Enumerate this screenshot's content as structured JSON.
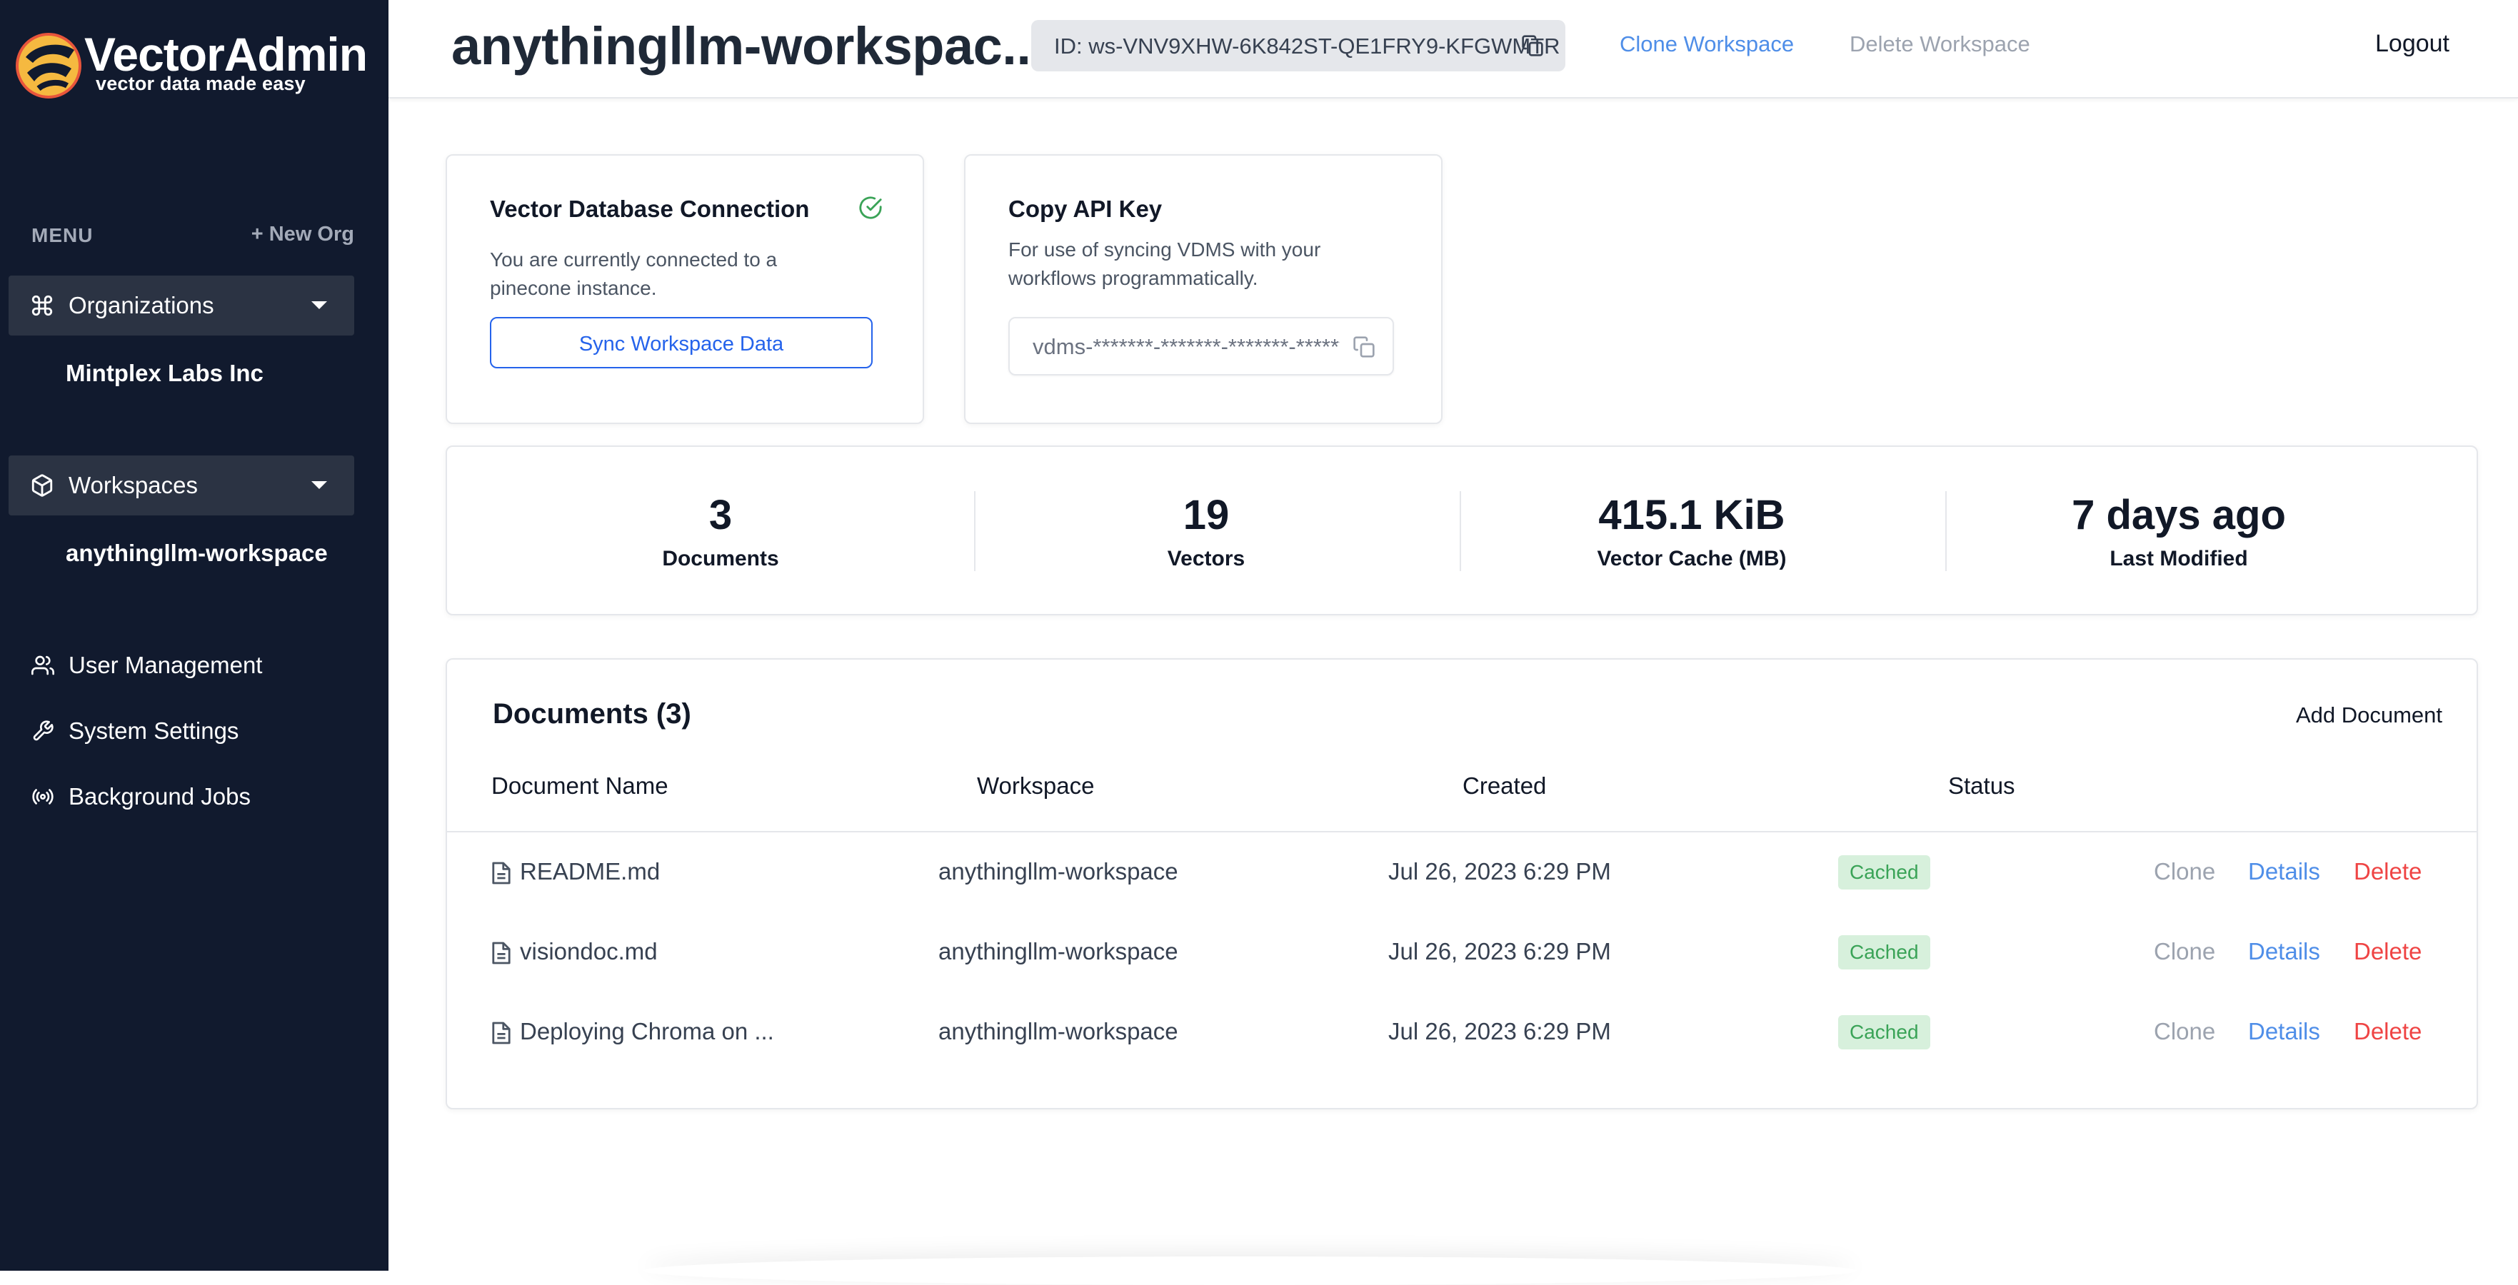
{
  "app": {
    "name": "VectorAdmin",
    "tagline": "vector data made easy",
    "colors": {
      "sidebar_bg": "#111a2e",
      "accent": "#2563eb",
      "cached": "#3aa357",
      "danger": "#ef4444"
    }
  },
  "sidebar": {
    "menu_label": "MENU",
    "new_org_label": "+ New Org",
    "organizations": {
      "label": "Organizations",
      "icon": "command-icon",
      "items": [
        "Mintplex Labs Inc"
      ]
    },
    "workspaces": {
      "label": "Workspaces",
      "icon": "cube-icon",
      "items": [
        "anythingllm-workspace"
      ]
    },
    "links": [
      {
        "label": "User Management",
        "icon": "users-icon"
      },
      {
        "label": "System Settings",
        "icon": "wrench-icon"
      },
      {
        "label": "Background Jobs",
        "icon": "broadcast-icon"
      }
    ]
  },
  "header": {
    "title": "anythingllm-workspac...",
    "id_text": "ID: ws-VNV9XHW-6K842ST-QE1FRY9-KFGWMTR",
    "clone_label": "Clone Workspace",
    "delete_label": "Delete Workspace",
    "logout_label": "Logout"
  },
  "connection_card": {
    "title": "Vector Database Connection",
    "description": "You are currently connected to a pinecone instance.",
    "button_label": "Sync Workspace Data"
  },
  "api_card": {
    "title": "Copy API Key",
    "description": "For use of syncing VDMS with your workflows programmatically.",
    "key_value": "vdms-*******-*******-*******-*******"
  },
  "stats": [
    {
      "value": "3",
      "label": "Documents"
    },
    {
      "value": "19",
      "label": "Vectors"
    },
    {
      "value": "415.1 KiB",
      "label": "Vector Cache (MB)"
    },
    {
      "value": "7 days ago",
      "label": "Last Modified"
    }
  ],
  "documents": {
    "title": "Documents (3)",
    "add_label": "Add Document",
    "columns": [
      "Document Name",
      "Workspace",
      "Created",
      "Status"
    ],
    "rows": [
      {
        "name": "README.md",
        "workspace": "anythingllm-workspace",
        "created": "Jul 26, 2023 6:29 PM",
        "status": "Cached"
      },
      {
        "name": "visiondoc.md",
        "workspace": "anythingllm-workspace",
        "created": "Jul 26, 2023 6:29 PM",
        "status": "Cached"
      },
      {
        "name": "Deploying Chroma on ...",
        "workspace": "anythingllm-workspace",
        "created": "Jul 26, 2023 6:29 PM",
        "status": "Cached"
      }
    ],
    "actions": {
      "clone": "Clone",
      "details": "Details",
      "delete": "Delete"
    }
  }
}
